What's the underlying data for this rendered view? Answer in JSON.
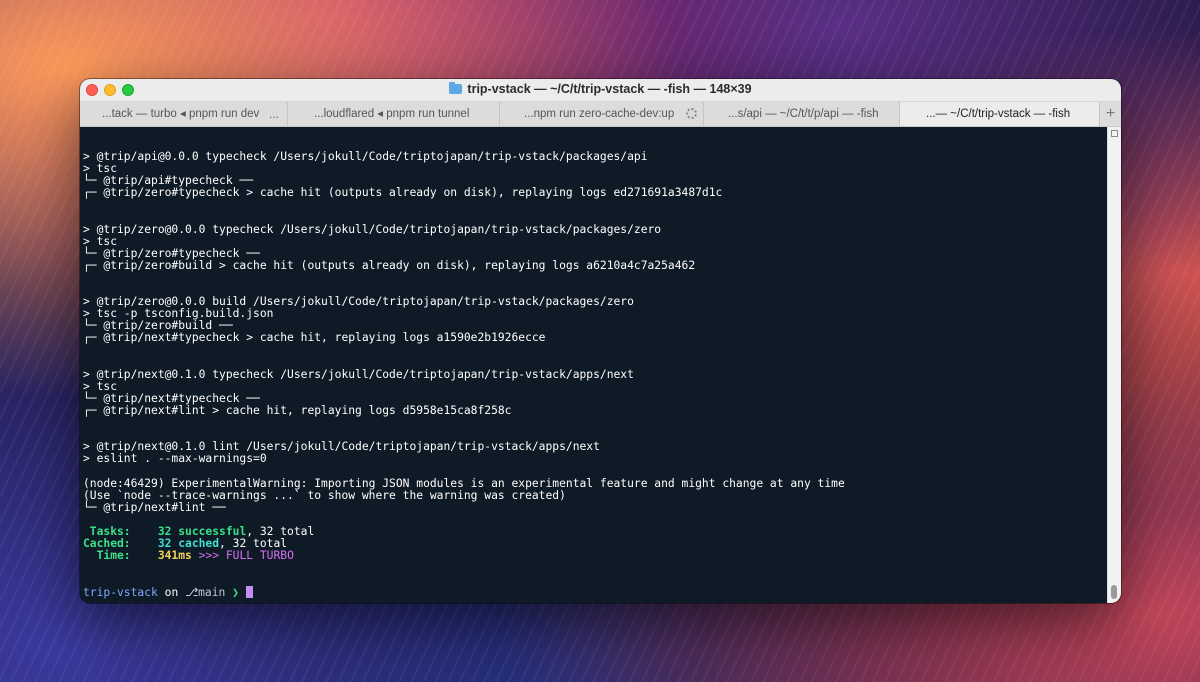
{
  "window": {
    "title": "trip-vstack — ~/C/t/trip-vstack — -fish — 148×39",
    "tabs": [
      {
        "label": "...tack — turbo ◂ pnpm run dev",
        "trailing": "..."
      },
      {
        "label": "...loudflared ◂ pnpm run tunnel",
        "trailing": ""
      },
      {
        "label": "...npm run zero-cache-dev:up",
        "trailing": "spinner"
      },
      {
        "label": "...s/api — ~/C/t/t/p/api — -fish",
        "trailing": ""
      },
      {
        "label": "...— ~/C/t/trip-vstack — -fish",
        "trailing": ""
      }
    ],
    "new_tab_label": "+"
  },
  "terminal": {
    "blocks": [
      {
        "cmd": "> @trip/api@0.0.0 typecheck /Users/jokull/Code/triptojapan/trip-vstack/packages/api",
        "run": "> tsc",
        "done": "└─ @trip/api#typecheck ──",
        "next": "┌─ @trip/zero#typecheck > cache hit (outputs already on disk), replaying logs ed271691a3487d1c"
      },
      {
        "cmd": "> @trip/zero@0.0.0 typecheck /Users/jokull/Code/triptojapan/trip-vstack/packages/zero",
        "run": "> tsc",
        "done": "└─ @trip/zero#typecheck ──",
        "next": "┌─ @trip/zero#build > cache hit (outputs already on disk), replaying logs a6210a4c7a25a462"
      },
      {
        "cmd": "> @trip/zero@0.0.0 build /Users/jokull/Code/triptojapan/trip-vstack/packages/zero",
        "run": "> tsc -p tsconfig.build.json",
        "done": "└─ @trip/zero#build ──",
        "next": "┌─ @trip/next#typecheck > cache hit, replaying logs a1590e2b1926ecce"
      },
      {
        "cmd": "> @trip/next@0.1.0 typecheck /Users/jokull/Code/triptojapan/trip-vstack/apps/next",
        "run": "> tsc",
        "done": "└─ @trip/next#typecheck ──",
        "next": "┌─ @trip/next#lint > cache hit, replaying logs d5958e15ca8f258c"
      }
    ],
    "lint_cmd": "> @trip/next@0.1.0 lint /Users/jokull/Code/triptojapan/trip-vstack/apps/next",
    "lint_run": "> eslint . --max-warnings=0",
    "warning_1": "(node:46429) ExperimentalWarning: Importing JSON modules is an experimental feature and might change at any time",
    "warning_2": "(Use `node --trace-warnings ...` to show where the warning was created)",
    "lint_done": "└─ @trip/next#lint ──",
    "summary": {
      "tasks_label": " Tasks:",
      "tasks_value": "32 successful",
      "tasks_total": ", 32 total",
      "cached_label": "Cached:",
      "cached_value": "32 cached",
      "cached_total": ", 32 total",
      "time_label": "  Time:",
      "time_value": "341ms",
      "turbo": ">>> FULL TURBO"
    },
    "prompt": {
      "dir": "trip-vstack",
      "on": "on",
      "branch_icon": "",
      "branch": "main",
      "arrow": "❯"
    }
  },
  "colors": {
    "terminal_bg": "#0e1a25",
    "success": "#3de08a",
    "cached": "#42e0d0",
    "time": "#f2d15a",
    "turbo": "#d670f2",
    "prompt_dir": "#7da7ff",
    "cursor": "#c58ef5"
  }
}
